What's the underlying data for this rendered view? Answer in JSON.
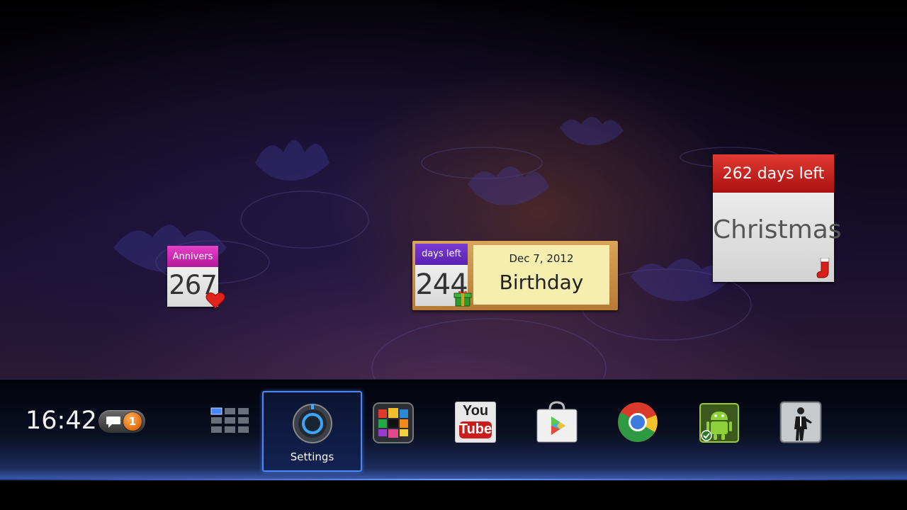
{
  "widgets": {
    "anniversary": {
      "header": "Annivers",
      "days": "267"
    },
    "birthday": {
      "header": "days left",
      "days": "244",
      "date": "Dec 7, 2012",
      "title": "Birthday"
    },
    "christmas": {
      "header": "262 days left",
      "title": "Christmas"
    }
  },
  "dock": {
    "time": "16:42",
    "notification_count": "1",
    "apps": [
      {
        "name": "all-apps",
        "icon": "grid-icon"
      },
      {
        "name": "settings",
        "label": "Settings",
        "icon": "gear-icon",
        "selected": true
      },
      {
        "name": "tv-guide",
        "icon": "colored-blocks-icon"
      },
      {
        "name": "youtube",
        "icon": "youtube-icon",
        "logo_top": "You",
        "logo_bottom": "Tube"
      },
      {
        "name": "play-store",
        "icon": "play-store-icon"
      },
      {
        "name": "chrome",
        "icon": "chrome-icon"
      },
      {
        "name": "android-app",
        "icon": "android-icon"
      },
      {
        "name": "game-app",
        "icon": "figure-icon"
      }
    ]
  },
  "colors": {
    "anniversary_header": "#d22ab4",
    "birthday_header": "#6a30c8",
    "christmas_header": "#c4201c",
    "selection_border": "#4a86ff"
  }
}
